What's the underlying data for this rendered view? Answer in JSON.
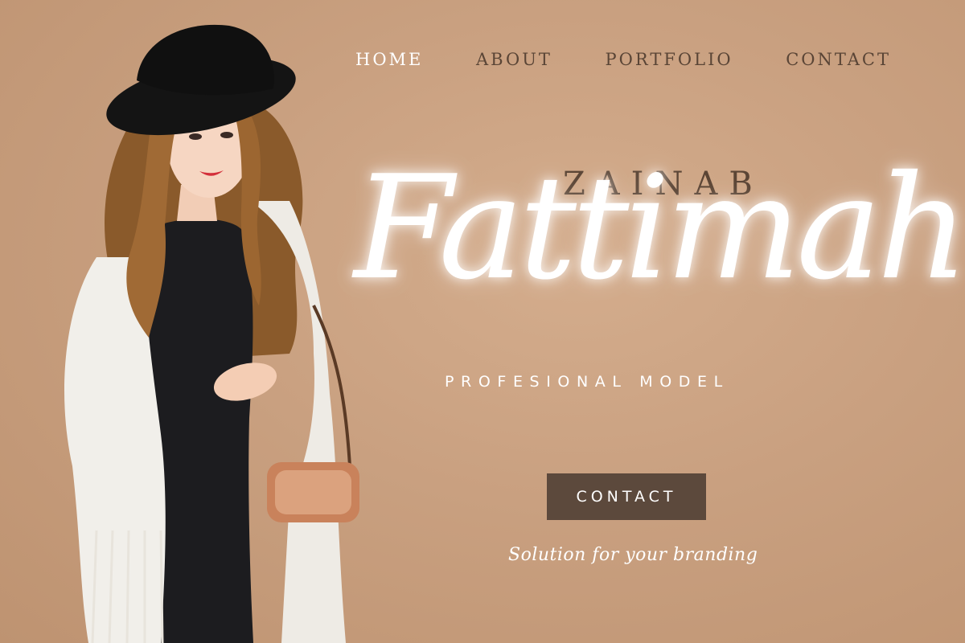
{
  "nav": {
    "items": [
      {
        "label": "HOME",
        "active": true
      },
      {
        "label": "ABOUT",
        "active": false
      },
      {
        "label": "PORTFOLIO",
        "active": false
      },
      {
        "label": "CONTACT",
        "active": false
      }
    ]
  },
  "hero": {
    "first_name": "ZAINAB",
    "last_name": "Fattimah",
    "subtitle": "PROFESIONAL MODEL",
    "cta_label": "CONTACT",
    "tagline": "Solution for your branding"
  },
  "colors": {
    "background": "#c9a080",
    "accent_dark": "#5c493c",
    "text_light": "#ffffff"
  }
}
